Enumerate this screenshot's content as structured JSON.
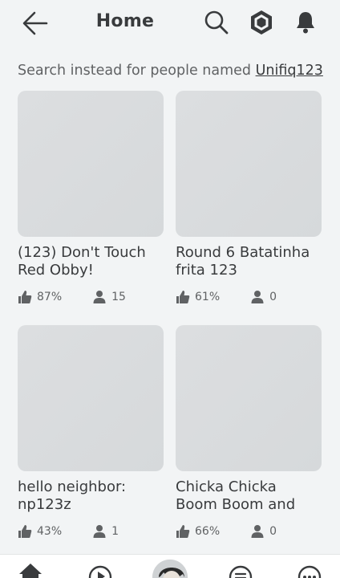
{
  "header": {
    "title": "Home"
  },
  "search_instead": {
    "prefix": "Search instead for people named ",
    "query": "Unifiq123"
  },
  "games": [
    {
      "title": "(123) Don't Touch Red Obby!",
      "rating": "87%",
      "players": "15"
    },
    {
      "title": "Round 6 Batatinha frita 123",
      "rating": "61%",
      "players": "0"
    },
    {
      "title": "hello neighbor: np123z",
      "rating": "43%",
      "players": "1"
    },
    {
      "title": "Chicka Chicka Boom Boom and",
      "rating": "66%",
      "players": "0"
    }
  ],
  "colors": {
    "background": "#f2f4f5",
    "text": "#393b3d",
    "thumbnail": "#d9dbdd"
  },
  "icons": {
    "header": [
      "back-arrow-icon",
      "search-icon",
      "robux-icon",
      "bell-icon"
    ],
    "stats": [
      "thumbs-up-icon",
      "person-icon"
    ],
    "nav": [
      "home-icon",
      "play-icon",
      "avatar",
      "chat-icon",
      "more-icon"
    ]
  }
}
